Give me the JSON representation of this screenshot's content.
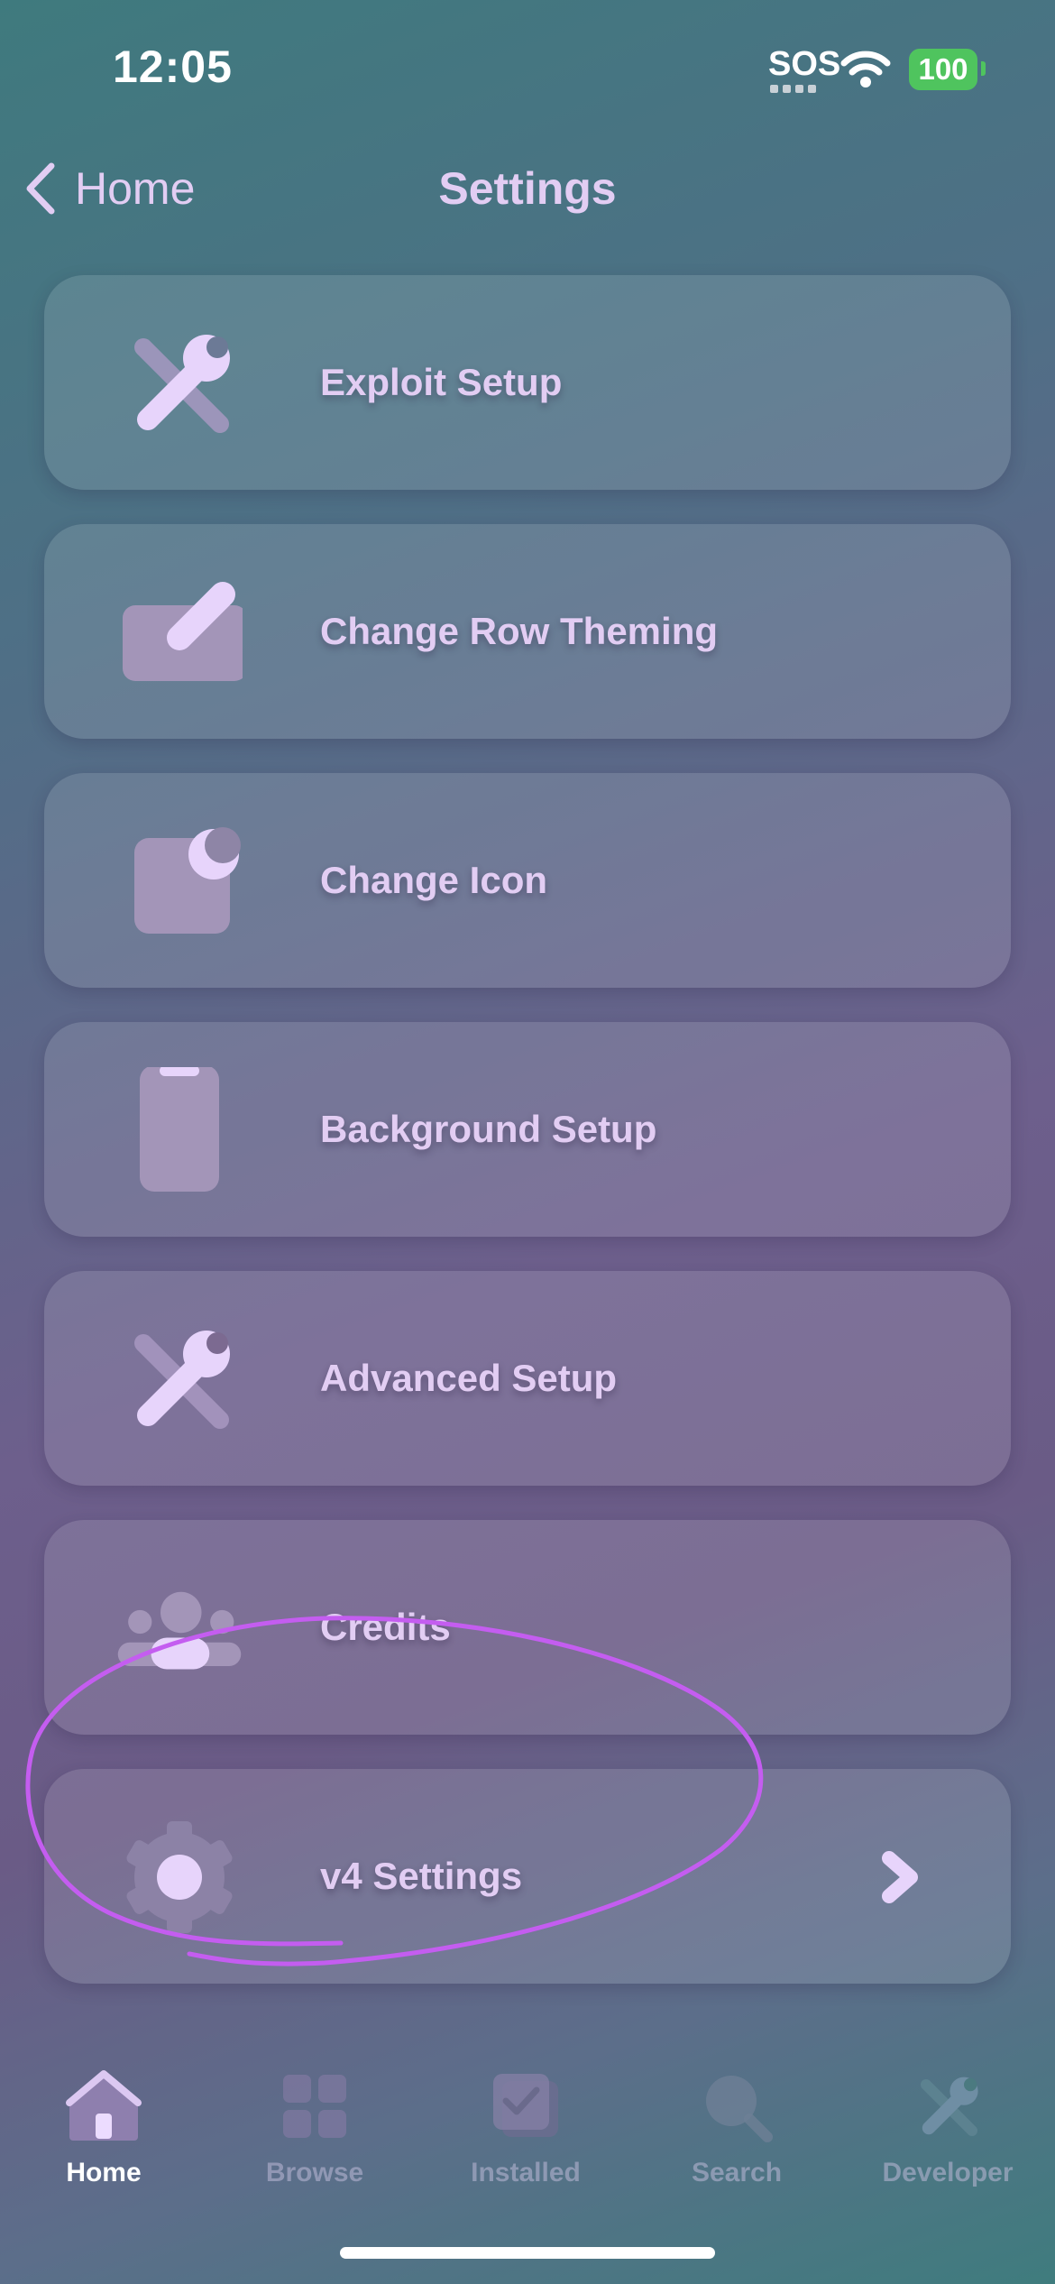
{
  "status_bar": {
    "time": "12:05",
    "carrier": "SOS",
    "battery": "100",
    "icons": [
      "wifi-icon",
      "battery-icon"
    ]
  },
  "nav": {
    "back_label": "Home",
    "title": "Settings"
  },
  "rows": [
    {
      "label": "Exploit Setup",
      "icon": "wrench-screwdriver-icon"
    },
    {
      "label": "Change Row Theming",
      "icon": "pencil-icon"
    },
    {
      "label": "Change Icon",
      "icon": "app-icon"
    },
    {
      "label": "Background Setup",
      "icon": "phone-icon"
    },
    {
      "label": "Advanced Setup",
      "icon": "wrench-screwdriver-icon"
    },
    {
      "label": "Credits",
      "icon": "people-icon"
    },
    {
      "label": "v4 Settings",
      "icon": "gear-icon"
    }
  ],
  "tabs": [
    {
      "label": "Home",
      "icon": "house-icon",
      "active": true
    },
    {
      "label": "Browse",
      "icon": "grid-icon",
      "active": false
    },
    {
      "label": "Installed",
      "icon": "checkbox-icon",
      "active": false
    },
    {
      "label": "Search",
      "icon": "magnifier-icon",
      "active": false
    },
    {
      "label": "Developer",
      "icon": "wrench-screwdriver-icon",
      "active": false
    }
  ],
  "colors": {
    "accent": "#e2cdf3",
    "annotation": "#c45df0",
    "battery": "#4fc45e"
  }
}
